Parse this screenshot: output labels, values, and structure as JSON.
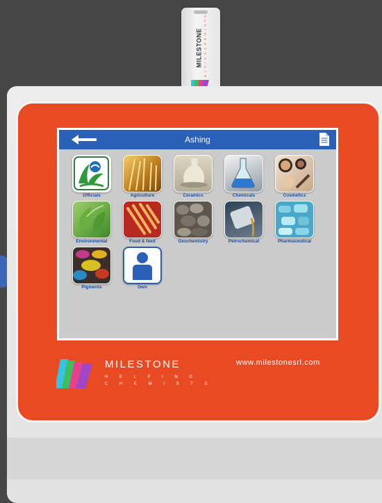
{
  "usb": {
    "brand": "MILESTONE",
    "tagline": "H E L P I N G   C H E M I S T S"
  },
  "screen": {
    "title": "Ashing",
    "back_icon": "arrow-left-icon",
    "doc_icon": "document-icon"
  },
  "categories": [
    {
      "label": "Officials",
      "icon": "epa-logo-icon"
    },
    {
      "label": "Agriculture",
      "icon": "wheat-icon"
    },
    {
      "label": "Ceramics",
      "icon": "ceramic-vase-icon"
    },
    {
      "label": "Chemicals",
      "icon": "flask-icon"
    },
    {
      "label": "Cosmetics",
      "icon": "makeup-icon"
    },
    {
      "label": "Environmental",
      "icon": "leaves-icon"
    },
    {
      "label": "Food & feed",
      "icon": "breadsticks-icon"
    },
    {
      "label": "Geochemistry",
      "icon": "rocks-icon"
    },
    {
      "label": "Petrochemical",
      "icon": "oil-can-icon"
    },
    {
      "label": "Pharmaceutical",
      "icon": "pills-icon"
    },
    {
      "label": "Pigments",
      "icon": "pigment-bowls-icon"
    },
    {
      "label": "Own",
      "icon": "user-icon"
    }
  ],
  "brand": {
    "name": "MILESTONE",
    "tagline_line1": "H E L P I N G",
    "tagline_line2": "C H E M I S T S",
    "url": "www.milestonesrl.com"
  },
  "colors": {
    "panel": "#e84a23",
    "titlebar": "#2a60b6",
    "screen_bg": "#cbcbcb",
    "label": "#1e4a9c"
  }
}
